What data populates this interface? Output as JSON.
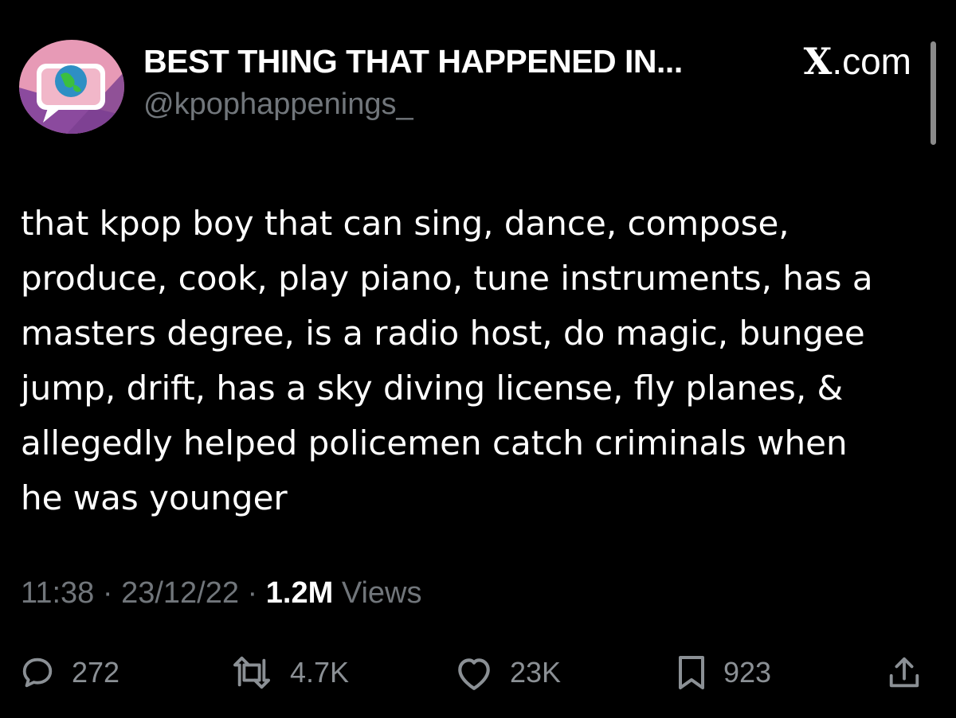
{
  "header": {
    "display_name": "BEST THING THAT HAPPENED IN...",
    "handle": "@kpophappenings_",
    "source_label": ".com",
    "source_letter": "X"
  },
  "tweet": {
    "text": "that kpop boy that can sing, dance, compose,\nproduce, cook, play piano, tune instruments, has a\nmasters degree, is a radio host, do magic, bungee\njump, drift, has a sky diving license, fly planes, &\nallegedly helped policemen catch criminals when\nhe was younger",
    "time": "11:38",
    "date": "23/12/22",
    "separator": "·",
    "views_count": "1.2M",
    "views_label": "Views"
  },
  "actions": {
    "replies": "272",
    "reposts": "4.7K",
    "likes": "23K",
    "bookmarks": "923"
  },
  "colors": {
    "background": "#000000",
    "text_primary": "#ffffff",
    "text_secondary": "#71767b",
    "avatar_pink": "#e79ab6",
    "avatar_purple": "#8b4a9e"
  },
  "icons": [
    "reply-icon",
    "repost-icon",
    "like-icon",
    "bookmark-icon",
    "share-icon"
  ]
}
